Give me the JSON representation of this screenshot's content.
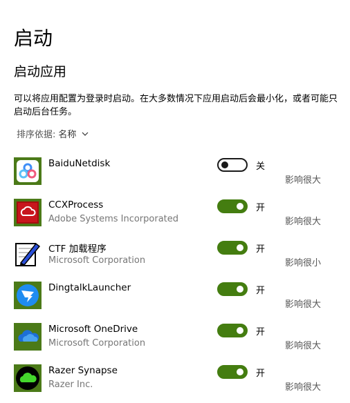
{
  "page": {
    "title": "启动",
    "section_title": "启动应用",
    "description": "可以将应用配置为登录时启动。在大多数情况下应用启动后会最小化，或者可能只启动后台任务。",
    "sort": {
      "label": "排序依据:",
      "value": "名称"
    }
  },
  "apps": [
    {
      "name": "BaiduNetdisk",
      "publisher": "",
      "enabled": false,
      "state_label": "关",
      "impact": "影响很大",
      "icon": "baidu-netdisk-icon"
    },
    {
      "name": "CCXProcess",
      "publisher": "Adobe Systems Incorporated",
      "enabled": true,
      "state_label": "开",
      "impact": "影响很大",
      "icon": "adobe-creative-cloud-icon"
    },
    {
      "name": "CTF 加载程序",
      "publisher": "Microsoft Corporation",
      "enabled": true,
      "state_label": "开",
      "impact": "影响很小",
      "icon": "ctf-loader-icon"
    },
    {
      "name": "DingtalkLauncher",
      "publisher": "",
      "enabled": true,
      "state_label": "开",
      "impact": "影响很大",
      "icon": "dingtalk-icon"
    },
    {
      "name": "Microsoft OneDrive",
      "publisher": "Microsoft Corporation",
      "enabled": true,
      "state_label": "开",
      "impact": "影响很大",
      "icon": "onedrive-icon"
    },
    {
      "name": "Razer Synapse",
      "publisher": "Razer Inc.",
      "enabled": true,
      "state_label": "开",
      "impact": "影响很大",
      "icon": "razer-synapse-icon"
    }
  ],
  "colors": {
    "toggle_on": "#447d10",
    "publisher_text": "#767676"
  }
}
